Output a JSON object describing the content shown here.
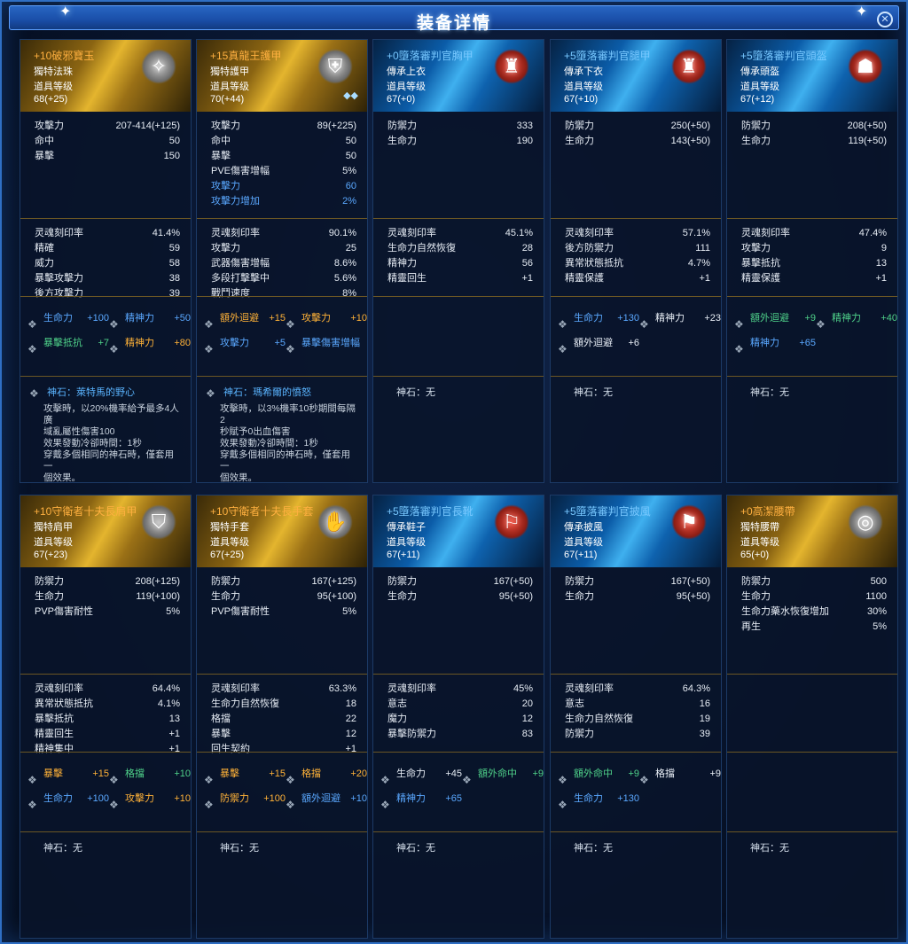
{
  "title": "装备详情",
  "cards": [
    {
      "id": "c0",
      "row": 1,
      "tone": "gold",
      "name": "+10破邪寶玉",
      "type": "獨特法珠",
      "lvl_label": "道具等级",
      "level": "68(+25)",
      "icon": "✧",
      "stats": [
        {
          "k": "攻擊力",
          "v": "207-414(+125)"
        },
        {
          "k": "命中",
          "v": "50"
        },
        {
          "k": "暴擊",
          "v": "150"
        }
      ],
      "soul": [
        {
          "k": "灵魂刻印率",
          "v": "41.4%"
        },
        {
          "k": "精確",
          "v": "59"
        },
        {
          "k": "威力",
          "v": "58"
        },
        {
          "k": "暴擊攻擊力",
          "v": "38"
        },
        {
          "k": "後方攻擊力",
          "v": "39"
        }
      ],
      "runes": [
        [
          {
            "k": "生命力",
            "v": "+100",
            "c": "cb"
          },
          {
            "k": "精神力",
            "v": "+50",
            "c": "cb"
          }
        ],
        [
          {
            "k": "暴擊抵抗",
            "v": "+7",
            "c": "cg"
          },
          {
            "k": "精神力",
            "v": "+80",
            "c": "co"
          }
        ]
      ],
      "gem": {
        "name": "神石：萊特馬的野心",
        "desc": [
          "攻擊時，以20%機率給予最多4人廣",
          "域亂屬性傷害100",
          "效果發動冷卻時間：1秒",
          "穿戴多個相同的神石時，僅套用一",
          "個效果。"
        ]
      }
    },
    {
      "id": "c1",
      "row": 1,
      "tone": "gold",
      "name": "+15真龍王護甲",
      "type": "獨特護甲",
      "lvl_label": "道具等级",
      "level": "70(+44)",
      "icon": "⛨",
      "gems": "◆◆",
      "stats": [
        {
          "k": "攻擊力",
          "v": "89(+225)"
        },
        {
          "k": "命中",
          "v": "50"
        },
        {
          "k": "暴擊",
          "v": "50"
        },
        {
          "k": "PVE傷害增幅",
          "v": "5%"
        },
        {
          "k": "攻擊力",
          "v": "60",
          "c": "blue"
        },
        {
          "k": "攻擊力增加",
          "v": "2%",
          "c": "blue"
        }
      ],
      "soul": [
        {
          "k": "灵魂刻印率",
          "v": "90.1%"
        },
        {
          "k": "攻擊力",
          "v": "25"
        },
        {
          "k": "武器傷害增幅",
          "v": "8.6%"
        },
        {
          "k": "多段打擊擊中",
          "v": "5.6%"
        },
        {
          "k": "戰鬥速度",
          "v": "8%"
        }
      ],
      "runes": [
        [
          {
            "k": "額外迴避",
            "v": "+15",
            "c": "co"
          },
          {
            "k": "攻擊力",
            "v": "+10",
            "c": "co"
          }
        ],
        [
          {
            "k": "攻擊力",
            "v": "+5",
            "c": "cb"
          },
          {
            "k": "暴擊傷害增幅",
            "v": "",
            "c": "cb"
          }
        ]
      ],
      "gem": {
        "name": "神石：瑪希爾的憤怒",
        "desc": [
          "攻擊時，以3%機率10秒期間每隔2",
          "秒賦予0出血傷害",
          "效果發動冷卻時間：1秒",
          "穿戴多個相同的神石時，僅套用一",
          "個效果。"
        ]
      }
    },
    {
      "id": "c2",
      "row": 1,
      "tone": "blue",
      "name": "+0墮落審判官胸甲",
      "type": "傳承上衣",
      "lvl_label": "道具等级",
      "level": "67(+0)",
      "icon": "♜",
      "stats": [
        {
          "k": "防禦力",
          "v": "333"
        },
        {
          "k": "生命力",
          "v": "190"
        }
      ],
      "soul": [
        {
          "k": "灵魂刻印率",
          "v": "45.1%"
        },
        {
          "k": "生命力自然恢復",
          "v": "28"
        },
        {
          "k": "精神力",
          "v": "56"
        },
        {
          "k": "精靈回生",
          "v": "+1"
        }
      ],
      "runes": [],
      "gem": {
        "name": "神石：无"
      }
    },
    {
      "id": "c3",
      "row": 1,
      "tone": "blue",
      "name": "+5墮落審判官腿甲",
      "type": "傳承下衣",
      "lvl_label": "道具等级",
      "level": "67(+10)",
      "icon": "♜",
      "stats": [
        {
          "k": "防禦力",
          "v": "250(+50)"
        },
        {
          "k": "生命力",
          "v": "143(+50)"
        }
      ],
      "soul": [
        {
          "k": "灵魂刻印率",
          "v": "57.1%"
        },
        {
          "k": "後方防禦力",
          "v": "111"
        },
        {
          "k": "異常狀態抵抗",
          "v": "4.7%"
        },
        {
          "k": "精靈保護",
          "v": "+1"
        }
      ],
      "runes": [
        [
          {
            "k": "生命力",
            "v": "+130",
            "c": "cb"
          },
          {
            "k": "精神力",
            "v": "+23",
            "c": "cw"
          }
        ],
        [
          {
            "k": "額外迴避",
            "v": "+6",
            "c": "cw"
          }
        ]
      ],
      "gem": {
        "name": "神石：无"
      }
    },
    {
      "id": "c4",
      "row": 1,
      "tone": "blue",
      "name": "+5墮落審判官頭盔",
      "type": "傳承頭盔",
      "lvl_label": "道具等级",
      "level": "67(+12)",
      "icon": "☗",
      "stats": [
        {
          "k": "防禦力",
          "v": "208(+50)"
        },
        {
          "k": "生命力",
          "v": "119(+50)"
        }
      ],
      "soul": [
        {
          "k": "灵魂刻印率",
          "v": "47.4%"
        },
        {
          "k": "攻擊力",
          "v": "9"
        },
        {
          "k": "暴擊抵抗",
          "v": "13"
        },
        {
          "k": "精靈保護",
          "v": "+1"
        }
      ],
      "runes": [
        [
          {
            "k": "額外迴避",
            "v": "+9",
            "c": "cg"
          },
          {
            "k": "精神力",
            "v": "+40",
            "c": "cg"
          }
        ],
        [
          {
            "k": "精神力",
            "v": "+65",
            "c": "cb"
          }
        ]
      ],
      "gem": {
        "name": "神石：无"
      }
    },
    {
      "id": "c0",
      "row": 2,
      "tone": "gold",
      "name": "+10守衛者十夫長肩甲",
      "type": "獨特肩甲",
      "lvl_label": "道具等级",
      "level": "67(+23)",
      "icon": "⛉",
      "stats": [
        {
          "k": "防禦力",
          "v": "208(+125)"
        },
        {
          "k": "生命力",
          "v": "119(+100)"
        },
        {
          "k": "PVP傷害耐性",
          "v": "5%"
        }
      ],
      "soul": [
        {
          "k": "灵魂刻印率",
          "v": "64.4%"
        },
        {
          "k": "異常狀態抵抗",
          "v": "4.1%"
        },
        {
          "k": "暴擊抵抗",
          "v": "13"
        },
        {
          "k": "精靈回生",
          "v": "+1"
        },
        {
          "k": "精神集中",
          "v": "+1"
        }
      ],
      "runes": [
        [
          {
            "k": "暴擊",
            "v": "+15",
            "c": "co"
          },
          {
            "k": "格擋",
            "v": "+10",
            "c": "cg"
          }
        ],
        [
          {
            "k": "生命力",
            "v": "+100",
            "c": "cb"
          },
          {
            "k": "攻擊力",
            "v": "+10",
            "c": "co"
          }
        ]
      ],
      "gem": {
        "name": "神石：无"
      }
    },
    {
      "id": "c1",
      "row": 2,
      "tone": "gold",
      "name": "+10守衛者十夫長手套",
      "type": "獨特手套",
      "lvl_label": "道具等级",
      "level": "67(+25)",
      "icon": "✋",
      "stats": [
        {
          "k": "防禦力",
          "v": "167(+125)"
        },
        {
          "k": "生命力",
          "v": "95(+100)"
        },
        {
          "k": "PVP傷害耐性",
          "v": "5%"
        }
      ],
      "soul": [
        {
          "k": "灵魂刻印率",
          "v": "63.3%"
        },
        {
          "k": "生命力自然恢復",
          "v": "18"
        },
        {
          "k": "格擋",
          "v": "22"
        },
        {
          "k": "暴擊",
          "v": "12"
        },
        {
          "k": "回生契約",
          "v": "+1"
        }
      ],
      "runes": [
        [
          {
            "k": "暴擊",
            "v": "+15",
            "c": "co"
          },
          {
            "k": "格擋",
            "v": "+20",
            "c": "co"
          }
        ],
        [
          {
            "k": "防禦力",
            "v": "+100",
            "c": "co"
          },
          {
            "k": "額外迴避",
            "v": "+10",
            "c": "cb"
          }
        ]
      ],
      "gem": {
        "name": "神石：无"
      }
    },
    {
      "id": "c2",
      "row": 2,
      "tone": "blue",
      "name": "+5墮落審判官長靴",
      "type": "傳承鞋子",
      "lvl_label": "道具等级",
      "level": "67(+11)",
      "icon": "⚐",
      "stats": [
        {
          "k": "防禦力",
          "v": "167(+50)"
        },
        {
          "k": "生命力",
          "v": "95(+50)"
        }
      ],
      "soul": [
        {
          "k": "灵魂刻印率",
          "v": "45%"
        },
        {
          "k": "意志",
          "v": "20"
        },
        {
          "k": "魔力",
          "v": "12"
        },
        {
          "k": "暴擊防禦力",
          "v": "83"
        }
      ],
      "runes": [
        [
          {
            "k": "生命力",
            "v": "+45",
            "c": "cw"
          },
          {
            "k": "額外命中",
            "v": "+9",
            "c": "cg"
          }
        ],
        [
          {
            "k": "精神力",
            "v": "+65",
            "c": "cb"
          }
        ]
      ],
      "gem": {
        "name": "神石：无"
      }
    },
    {
      "id": "c3",
      "row": 2,
      "tone": "blue",
      "name": "+5墮落審判官披風",
      "type": "傳承披風",
      "lvl_label": "道具等级",
      "level": "67(+11)",
      "icon": "⚑",
      "stats": [
        {
          "k": "防禦力",
          "v": "167(+50)"
        },
        {
          "k": "生命力",
          "v": "95(+50)"
        }
      ],
      "soul": [
        {
          "k": "灵魂刻印率",
          "v": "64.3%"
        },
        {
          "k": "意志",
          "v": "16"
        },
        {
          "k": "生命力自然恢復",
          "v": "19"
        },
        {
          "k": "防禦力",
          "v": "39"
        }
      ],
      "runes": [
        [
          {
            "k": "額外命中",
            "v": "+9",
            "c": "cg"
          },
          {
            "k": "格擋",
            "v": "+9",
            "c": "cw"
          }
        ],
        [
          {
            "k": "生命力",
            "v": "+130",
            "c": "cb"
          }
        ]
      ],
      "gem": {
        "name": "神石：无"
      }
    },
    {
      "id": "c4",
      "row": 2,
      "tone": "gold",
      "name": "+0高潔腰帶",
      "type": "獨特腰帶",
      "lvl_label": "道具等级",
      "level": "65(+0)",
      "icon": "◎",
      "stats": [
        {
          "k": "防禦力",
          "v": "500"
        },
        {
          "k": "生命力",
          "v": "1100"
        },
        {
          "k": "生命力藥水恢復增加",
          "v": "30%"
        },
        {
          "k": "再生",
          "v": "5%"
        }
      ],
      "soul": [],
      "runes": [],
      "gem": {
        "name": "神石：无"
      }
    }
  ]
}
